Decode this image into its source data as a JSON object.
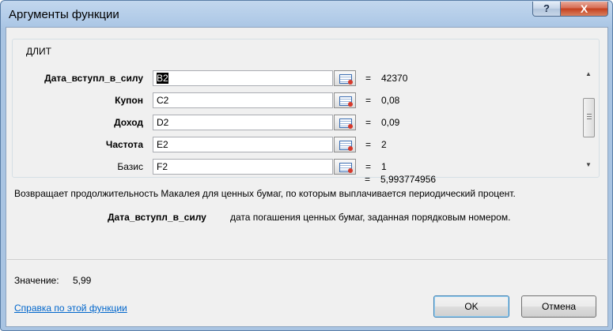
{
  "window": {
    "title": "Аргументы функции",
    "help_glyph": "?",
    "close_glyph": "X"
  },
  "function_group": {
    "name": "ДЛИТ"
  },
  "arguments": [
    {
      "label": "Дата_вступл_в_силу",
      "value": "B2",
      "result": "42370"
    },
    {
      "label": "Купон",
      "value": "C2",
      "result": "0,08"
    },
    {
      "label": "Доход",
      "value": "D2",
      "result": "0,09"
    },
    {
      "label": "Частота",
      "value": "E2",
      "result": "2"
    },
    {
      "label": "Базис",
      "value": "F2",
      "result": "1"
    }
  ],
  "equals_sign": "=",
  "function_result": "5,993774956",
  "description": "Возвращает продолжительность Макалея для ценных бумаг, по которым выплачивается периодический процент.",
  "arg_help": {
    "name": "Дата_вступл_в_силу",
    "text": "дата погашения ценных бумаг, заданная порядковым номером."
  },
  "formula_value": {
    "label": "Значение:",
    "value": "5,99"
  },
  "help_link": "Справка по этой функции",
  "buttons": {
    "ok": "OK",
    "cancel": "Отмена"
  },
  "icons": {
    "ref_button": "collapse-dialog-icon",
    "scroll_up": "scroll-up-arrow-icon",
    "scroll_down": "scroll-down-arrow-icon"
  },
  "colors": {
    "link": "#0066cc",
    "close_button": "#c5401f",
    "title_bar": "#adc8e6"
  }
}
